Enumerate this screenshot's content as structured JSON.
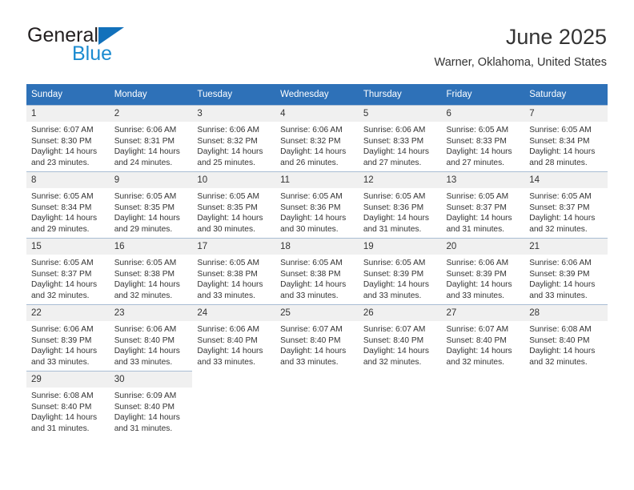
{
  "brand": {
    "name_part1": "General",
    "name_part2": "Blue",
    "flag_icon": "blue-triangle-flag-icon",
    "color_dark": "#231f20",
    "color_blue": "#1b8bd0"
  },
  "header": {
    "title": "June 2025",
    "location": "Warner, Oklahoma, United States"
  },
  "theme": {
    "header_blue": "#2e71b8",
    "daynum_bg": "#f0f0f0",
    "row_border": "#a9bdd4",
    "text": "#333333"
  },
  "calendar": {
    "weekday_headers": [
      "Sunday",
      "Monday",
      "Tuesday",
      "Wednesday",
      "Thursday",
      "Friday",
      "Saturday"
    ],
    "weeks": [
      [
        {
          "day": "1",
          "sunrise": "Sunrise: 6:07 AM",
          "sunset": "Sunset: 8:30 PM",
          "daylight_line1": "Daylight: 14 hours",
          "daylight_line2": "and 23 minutes."
        },
        {
          "day": "2",
          "sunrise": "Sunrise: 6:06 AM",
          "sunset": "Sunset: 8:31 PM",
          "daylight_line1": "Daylight: 14 hours",
          "daylight_line2": "and 24 minutes."
        },
        {
          "day": "3",
          "sunrise": "Sunrise: 6:06 AM",
          "sunset": "Sunset: 8:32 PM",
          "daylight_line1": "Daylight: 14 hours",
          "daylight_line2": "and 25 minutes."
        },
        {
          "day": "4",
          "sunrise": "Sunrise: 6:06 AM",
          "sunset": "Sunset: 8:32 PM",
          "daylight_line1": "Daylight: 14 hours",
          "daylight_line2": "and 26 minutes."
        },
        {
          "day": "5",
          "sunrise": "Sunrise: 6:06 AM",
          "sunset": "Sunset: 8:33 PM",
          "daylight_line1": "Daylight: 14 hours",
          "daylight_line2": "and 27 minutes."
        },
        {
          "day": "6",
          "sunrise": "Sunrise: 6:05 AM",
          "sunset": "Sunset: 8:33 PM",
          "daylight_line1": "Daylight: 14 hours",
          "daylight_line2": "and 27 minutes."
        },
        {
          "day": "7",
          "sunrise": "Sunrise: 6:05 AM",
          "sunset": "Sunset: 8:34 PM",
          "daylight_line1": "Daylight: 14 hours",
          "daylight_line2": "and 28 minutes."
        }
      ],
      [
        {
          "day": "8",
          "sunrise": "Sunrise: 6:05 AM",
          "sunset": "Sunset: 8:34 PM",
          "daylight_line1": "Daylight: 14 hours",
          "daylight_line2": "and 29 minutes."
        },
        {
          "day": "9",
          "sunrise": "Sunrise: 6:05 AM",
          "sunset": "Sunset: 8:35 PM",
          "daylight_line1": "Daylight: 14 hours",
          "daylight_line2": "and 29 minutes."
        },
        {
          "day": "10",
          "sunrise": "Sunrise: 6:05 AM",
          "sunset": "Sunset: 8:35 PM",
          "daylight_line1": "Daylight: 14 hours",
          "daylight_line2": "and 30 minutes."
        },
        {
          "day": "11",
          "sunrise": "Sunrise: 6:05 AM",
          "sunset": "Sunset: 8:36 PM",
          "daylight_line1": "Daylight: 14 hours",
          "daylight_line2": "and 30 minutes."
        },
        {
          "day": "12",
          "sunrise": "Sunrise: 6:05 AM",
          "sunset": "Sunset: 8:36 PM",
          "daylight_line1": "Daylight: 14 hours",
          "daylight_line2": "and 31 minutes."
        },
        {
          "day": "13",
          "sunrise": "Sunrise: 6:05 AM",
          "sunset": "Sunset: 8:37 PM",
          "daylight_line1": "Daylight: 14 hours",
          "daylight_line2": "and 31 minutes."
        },
        {
          "day": "14",
          "sunrise": "Sunrise: 6:05 AM",
          "sunset": "Sunset: 8:37 PM",
          "daylight_line1": "Daylight: 14 hours",
          "daylight_line2": "and 32 minutes."
        }
      ],
      [
        {
          "day": "15",
          "sunrise": "Sunrise: 6:05 AM",
          "sunset": "Sunset: 8:37 PM",
          "daylight_line1": "Daylight: 14 hours",
          "daylight_line2": "and 32 minutes."
        },
        {
          "day": "16",
          "sunrise": "Sunrise: 6:05 AM",
          "sunset": "Sunset: 8:38 PM",
          "daylight_line1": "Daylight: 14 hours",
          "daylight_line2": "and 32 minutes."
        },
        {
          "day": "17",
          "sunrise": "Sunrise: 6:05 AM",
          "sunset": "Sunset: 8:38 PM",
          "daylight_line1": "Daylight: 14 hours",
          "daylight_line2": "and 33 minutes."
        },
        {
          "day": "18",
          "sunrise": "Sunrise: 6:05 AM",
          "sunset": "Sunset: 8:38 PM",
          "daylight_line1": "Daylight: 14 hours",
          "daylight_line2": "and 33 minutes."
        },
        {
          "day": "19",
          "sunrise": "Sunrise: 6:05 AM",
          "sunset": "Sunset: 8:39 PM",
          "daylight_line1": "Daylight: 14 hours",
          "daylight_line2": "and 33 minutes."
        },
        {
          "day": "20",
          "sunrise": "Sunrise: 6:06 AM",
          "sunset": "Sunset: 8:39 PM",
          "daylight_line1": "Daylight: 14 hours",
          "daylight_line2": "and 33 minutes."
        },
        {
          "day": "21",
          "sunrise": "Sunrise: 6:06 AM",
          "sunset": "Sunset: 8:39 PM",
          "daylight_line1": "Daylight: 14 hours",
          "daylight_line2": "and 33 minutes."
        }
      ],
      [
        {
          "day": "22",
          "sunrise": "Sunrise: 6:06 AM",
          "sunset": "Sunset: 8:39 PM",
          "daylight_line1": "Daylight: 14 hours",
          "daylight_line2": "and 33 minutes."
        },
        {
          "day": "23",
          "sunrise": "Sunrise: 6:06 AM",
          "sunset": "Sunset: 8:40 PM",
          "daylight_line1": "Daylight: 14 hours",
          "daylight_line2": "and 33 minutes."
        },
        {
          "day": "24",
          "sunrise": "Sunrise: 6:06 AM",
          "sunset": "Sunset: 8:40 PM",
          "daylight_line1": "Daylight: 14 hours",
          "daylight_line2": "and 33 minutes."
        },
        {
          "day": "25",
          "sunrise": "Sunrise: 6:07 AM",
          "sunset": "Sunset: 8:40 PM",
          "daylight_line1": "Daylight: 14 hours",
          "daylight_line2": "and 33 minutes."
        },
        {
          "day": "26",
          "sunrise": "Sunrise: 6:07 AM",
          "sunset": "Sunset: 8:40 PM",
          "daylight_line1": "Daylight: 14 hours",
          "daylight_line2": "and 32 minutes."
        },
        {
          "day": "27",
          "sunrise": "Sunrise: 6:07 AM",
          "sunset": "Sunset: 8:40 PM",
          "daylight_line1": "Daylight: 14 hours",
          "daylight_line2": "and 32 minutes."
        },
        {
          "day": "28",
          "sunrise": "Sunrise: 6:08 AM",
          "sunset": "Sunset: 8:40 PM",
          "daylight_line1": "Daylight: 14 hours",
          "daylight_line2": "and 32 minutes."
        }
      ],
      [
        {
          "day": "29",
          "sunrise": "Sunrise: 6:08 AM",
          "sunset": "Sunset: 8:40 PM",
          "daylight_line1": "Daylight: 14 hours",
          "daylight_line2": "and 31 minutes."
        },
        {
          "day": "30",
          "sunrise": "Sunrise: 6:09 AM",
          "sunset": "Sunset: 8:40 PM",
          "daylight_line1": "Daylight: 14 hours",
          "daylight_line2": "and 31 minutes."
        },
        {
          "day": "",
          "sunrise": "",
          "sunset": "",
          "daylight_line1": "",
          "daylight_line2": ""
        },
        {
          "day": "",
          "sunrise": "",
          "sunset": "",
          "daylight_line1": "",
          "daylight_line2": ""
        },
        {
          "day": "",
          "sunrise": "",
          "sunset": "",
          "daylight_line1": "",
          "daylight_line2": ""
        },
        {
          "day": "",
          "sunrise": "",
          "sunset": "",
          "daylight_line1": "",
          "daylight_line2": ""
        },
        {
          "day": "",
          "sunrise": "",
          "sunset": "",
          "daylight_line1": "",
          "daylight_line2": ""
        }
      ]
    ]
  }
}
